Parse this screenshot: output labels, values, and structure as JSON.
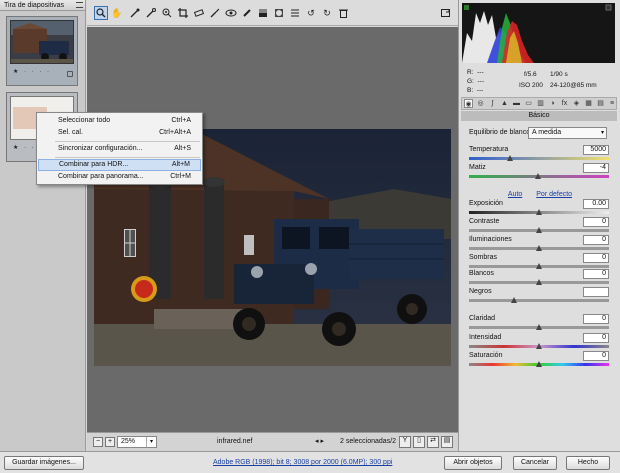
{
  "filmstrip": {
    "title": "Tira de diapositivas",
    "thumb1_stars": "★ · · · ·",
    "thumb2_stars": "★ · · · ·"
  },
  "context_menu": {
    "items": [
      {
        "label": "Seleccionar todo",
        "shortcut": "Ctrl+A"
      },
      {
        "label": "Sel. cal.",
        "shortcut": "Ctrl+Alt+A"
      },
      {
        "label": "Sincronizar configuración...",
        "shortcut": "Alt+S"
      },
      {
        "label": "Combinar para HDR...",
        "shortcut": "Alt+M"
      },
      {
        "label": "Combinar para panorama...",
        "shortcut": "Ctrl+M"
      }
    ],
    "highlighted_index": 3
  },
  "toolbar": {
    "icons": [
      "zoom-icon",
      "hand-icon",
      "white-balance-icon",
      "color-sampler-icon",
      "target-adjust-icon",
      "crop-icon",
      "straighten-icon",
      "spot-removal-icon",
      "red-eye-icon",
      "adjustment-brush-icon",
      "graduated-filter-icon",
      "radial-filter-icon",
      "preferences-icon",
      "rotate-left-icon",
      "rotate-right-icon",
      "trash-icon"
    ]
  },
  "canvas_bar": {
    "zoom": "25%",
    "filename": "infrared.nef",
    "selection": "2 seleccionadas/2"
  },
  "camera_info": {
    "r": "R:",
    "g": "G:",
    "b": "B:",
    "r_val": "---",
    "g_val": "---",
    "b_val": "---",
    "aperture": "f/5.6",
    "shutter": "1/90 s",
    "iso": "ISO 200",
    "lens": "24-120@85 mm"
  },
  "panel": {
    "section_title": "Básico",
    "wb_label": "Equilibrio de blancos:",
    "wb_value": "A medida",
    "temperature_label": "Temperatura",
    "temperature_value": "5000",
    "tint_label": "Matiz",
    "tint_value": "-4",
    "auto_link": "Auto",
    "default_link": "Por defecto",
    "sliders": [
      {
        "label": "Exposición",
        "value": "0.00"
      },
      {
        "label": "Contraste",
        "value": "0"
      },
      {
        "label": "Iluminaciones",
        "value": "0"
      },
      {
        "label": "Sombras",
        "value": "0"
      },
      {
        "label": "Blancos",
        "value": "0"
      },
      {
        "label": "Negros",
        "value": ""
      },
      {
        "label": "Claridad",
        "value": "0"
      },
      {
        "label": "Intensidad",
        "value": "0"
      },
      {
        "label": "Saturación",
        "value": "0"
      }
    ]
  },
  "bottom": {
    "save_label": "Guardar imágenes...",
    "workflow_link": "Adobe RGB (1998); bit 8; 3008 por 2000 (6.0MP); 300 ppi",
    "open_label": "Abrir objetos",
    "cancel_label": "Cancelar",
    "done_label": "Hecho"
  },
  "colors": {
    "accent": "#3c6fae",
    "link": "#1a3fa5"
  }
}
